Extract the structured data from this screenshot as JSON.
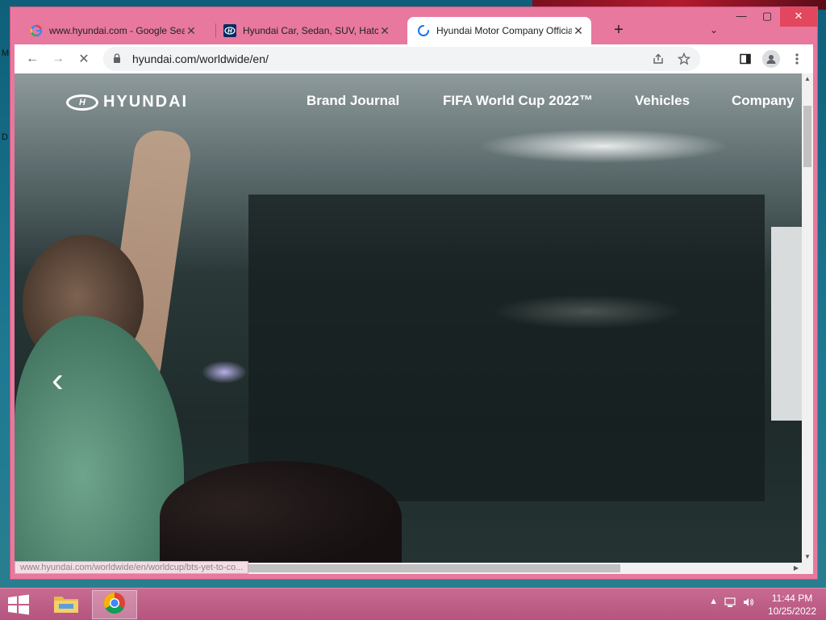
{
  "desktop": {
    "left_letters": [
      "M",
      "D"
    ]
  },
  "browser": {
    "tabs": [
      {
        "title": "www.hyundai.com - Google Sear",
        "icon": "google-icon",
        "close": "✕"
      },
      {
        "title": "Hyundai Car, Sedan, SUV, HatchB",
        "icon": "hyundai-favicon",
        "close": "✕"
      },
      {
        "title": "Hyundai Motor Company Officia",
        "icon": "loading-spinner-icon",
        "close": "✕"
      }
    ],
    "new_tab": "+",
    "tab_search": "⌄",
    "window_controls": {
      "minimize": "—",
      "maximize": "▢",
      "close": "✕"
    },
    "toolbar": {
      "back": "←",
      "forward": "→",
      "stop": "✕",
      "url": "hyundai.com/worldwide/en/"
    },
    "status_url": "www.hyundai.com/worldwide/en/worldcup/bts-yet-to-co..."
  },
  "page": {
    "logo_mark": "H",
    "logo_text": "HYUNDAI",
    "nav": [
      "Brand Journal",
      "FIFA World Cup 2022™",
      "Vehicles",
      "Company"
    ],
    "carousel_prev": "‹"
  },
  "taskbar": {
    "clock_time": "11:44 PM",
    "clock_date": "10/25/2022"
  }
}
